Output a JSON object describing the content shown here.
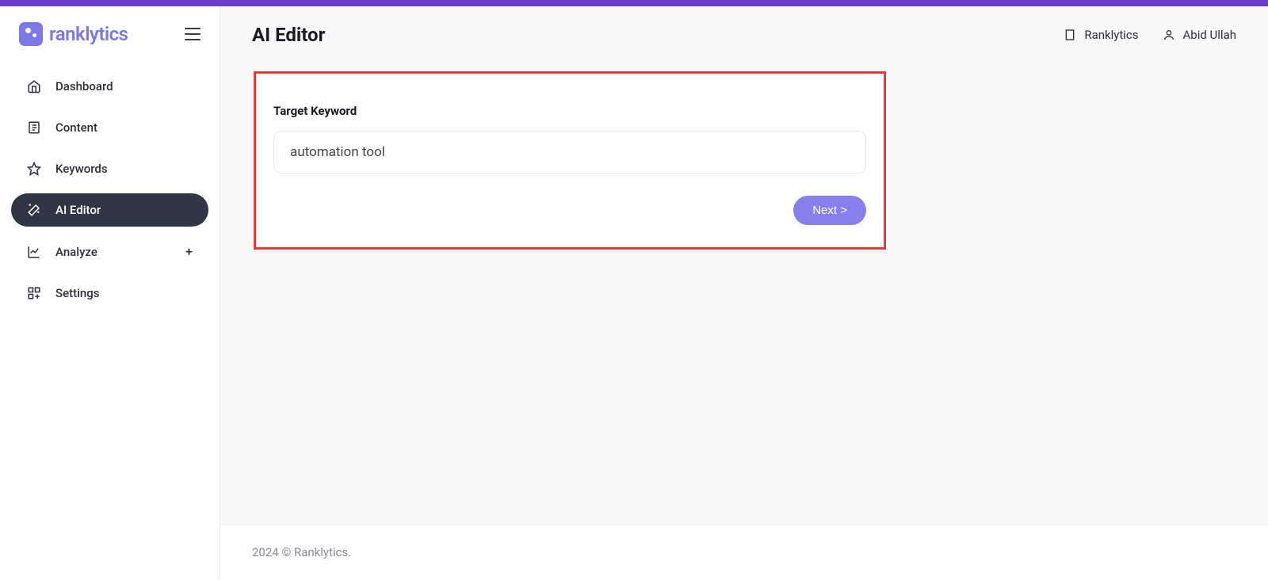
{
  "brand": "ranklytics",
  "sidebar": {
    "items": [
      {
        "label": "Dashboard"
      },
      {
        "label": "Content"
      },
      {
        "label": "Keywords"
      },
      {
        "label": "AI Editor"
      },
      {
        "label": "Analyze"
      },
      {
        "label": "Settings"
      }
    ]
  },
  "header": {
    "title": "AI Editor",
    "workspace": "Ranklytics",
    "user": "Abid Ullah"
  },
  "form": {
    "keyword_label": "Target Keyword",
    "keyword_value": "automation tool",
    "next_label": "Next >"
  },
  "footer": "2024 © Ranklytics."
}
